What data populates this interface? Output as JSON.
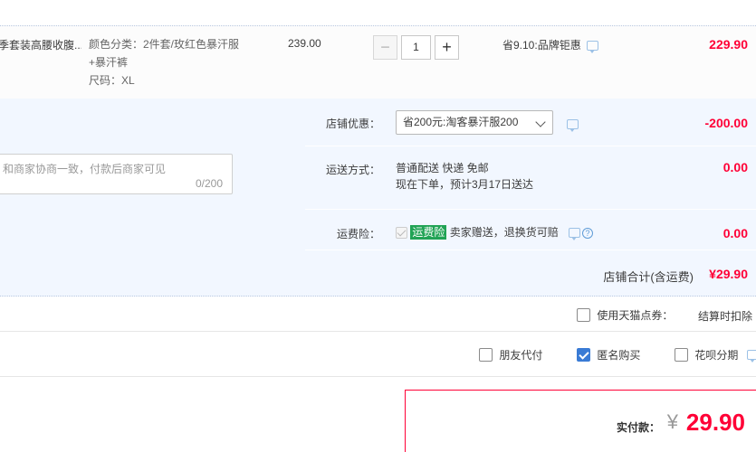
{
  "item": {
    "title": "季套装高腰收腹...",
    "sku_lines": [
      "颜色分类：2件套/玫红色暴汗服",
      "+暴汗裤",
      "尺码：XL"
    ],
    "price": "239.00",
    "quantity": "1",
    "minus_label": "−",
    "plus_label": "+",
    "promo": "省9.10:品牌钜惠",
    "total": "229.90"
  },
  "message": {
    "placeholder": "和商家协商一致，付款后商家可见",
    "count": "0/200"
  },
  "shop_discount": {
    "label": "店铺优惠：",
    "selected": "省200元:淘客暴汗服200",
    "amount": "-200.00"
  },
  "shipping": {
    "label": "运送方式：",
    "method": "普通配送 快递 免邮",
    "eta": "现在下单，预计3月17日送达",
    "amount": "0.00"
  },
  "insurance": {
    "label": "运费险：",
    "badge": "运费险",
    "text": "卖家赠送，退换货可赔",
    "help": "?",
    "amount": "0.00"
  },
  "shop_total": {
    "label": "店铺合计(含运费)",
    "amount": "¥29.90"
  },
  "tmall_points": {
    "label": "使用天猫点券：",
    "note": "结算时扣除"
  },
  "options": {
    "friend_pay": "朋友代付",
    "anonymous": "匿名购买",
    "huabei": "花呗分期"
  },
  "payment": {
    "label": "实付款：",
    "currency": "¥",
    "amount": "29.90"
  },
  "colors": {
    "accent_red": "#ff0036",
    "panel_bg": "#f2f7ff",
    "insurance_green": "#21a355",
    "checkbox_blue": "#3a7bd5"
  }
}
